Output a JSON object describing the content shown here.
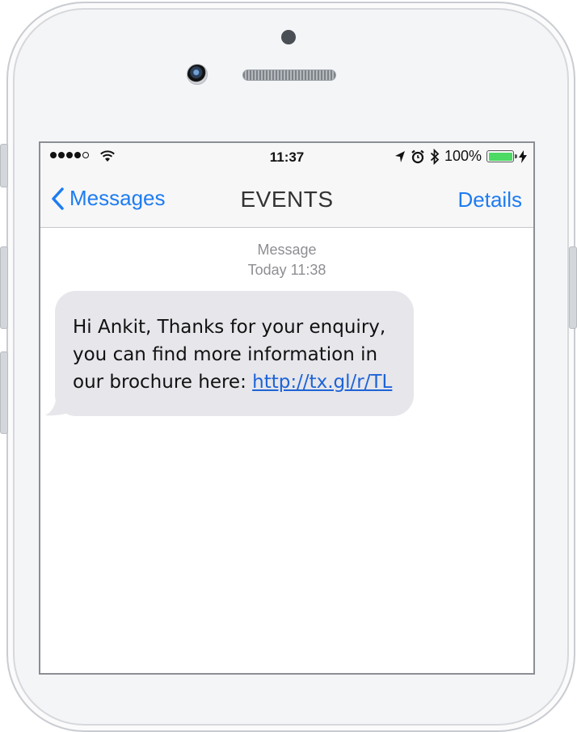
{
  "status_bar": {
    "signal_dots_filled": 4,
    "signal_dots_total": 5,
    "time": "11:37",
    "battery_percent": "100%",
    "battery_level": 1.0,
    "battery_color": "#4cd964",
    "icons": [
      "wifi-icon",
      "location-arrow-icon",
      "alarm-icon",
      "bluetooth-icon",
      "charging-bolt-icon"
    ]
  },
  "nav": {
    "back_label": "Messages",
    "title": "EVENTS",
    "details_label": "Details"
  },
  "thread": {
    "header_label": "Message",
    "header_timestamp": "Today 11:38",
    "messages": [
      {
        "line1": "Hi Ankit, Thanks for your enquiry,",
        "line2": "you can find more information in",
        "line3_prefix": "our brochure here: ",
        "link": "http://tx.gl/r/TL"
      }
    ]
  },
  "colors": {
    "accent": "#1e7cf2",
    "bubble": "#e6e6eb",
    "link": "#1e63d6"
  }
}
